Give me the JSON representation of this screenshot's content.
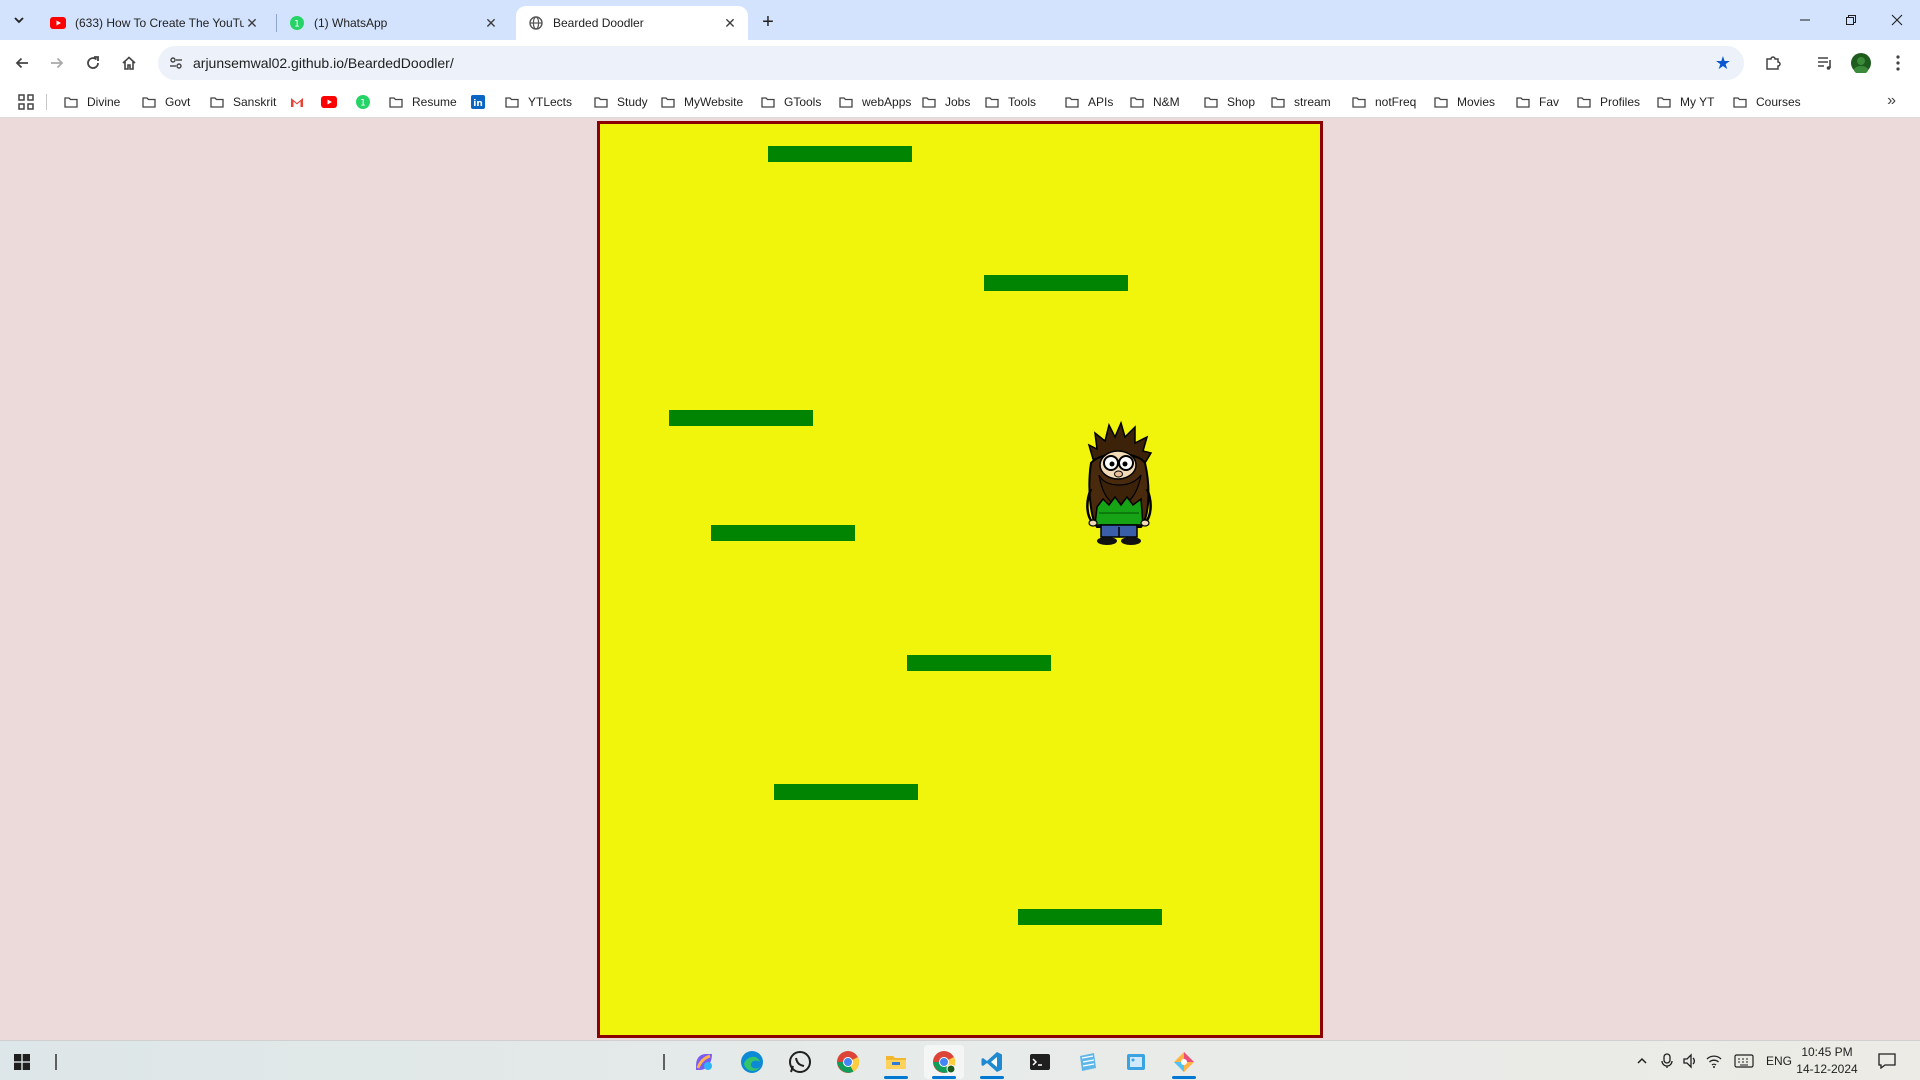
{
  "browser": {
    "tabs": [
      {
        "title": "(633) How To Create The YouTu",
        "favicon": "youtube-icon",
        "active": false
      },
      {
        "title": "(1) WhatsApp",
        "favicon": "whatsapp-icon",
        "active": false
      },
      {
        "title": "Bearded Doodler",
        "favicon": "globe-icon",
        "active": true
      }
    ],
    "url": "arjunsemwal02.github.io/BeardedDoodler/",
    "bookmarks": [
      {
        "label": "Divine",
        "icon": "folder-icon"
      },
      {
        "label": "Govt",
        "icon": "folder-icon"
      },
      {
        "label": "Sanskrit",
        "icon": "folder-icon"
      },
      {
        "label": "",
        "icon": "gmail-icon"
      },
      {
        "label": "",
        "icon": "youtube-icon"
      },
      {
        "label": "",
        "icon": "whatsapp-icon"
      },
      {
        "label": "Resume",
        "icon": "folder-icon"
      },
      {
        "label": "",
        "icon": "linkedin-icon"
      },
      {
        "label": "YTLects",
        "icon": "folder-icon"
      },
      {
        "label": "Study",
        "icon": "folder-icon"
      },
      {
        "label": "MyWebsite",
        "icon": "folder-icon"
      },
      {
        "label": "GTools",
        "icon": "folder-icon"
      },
      {
        "label": "webApps",
        "icon": "folder-icon"
      },
      {
        "label": "Jobs",
        "icon": "folder-icon"
      },
      {
        "label": "Tools",
        "icon": "folder-icon"
      },
      {
        "label": "APIs",
        "icon": "folder-icon"
      },
      {
        "label": "N&M",
        "icon": "folder-icon"
      },
      {
        "label": "Shop",
        "icon": "folder-icon"
      },
      {
        "label": "stream",
        "icon": "folder-icon"
      },
      {
        "label": "notFreq",
        "icon": "folder-icon"
      },
      {
        "label": "Movies",
        "icon": "folder-icon"
      },
      {
        "label": "Fav",
        "icon": "folder-icon"
      },
      {
        "label": "Profiles",
        "icon": "folder-icon"
      },
      {
        "label": "My YT",
        "icon": "folder-icon"
      },
      {
        "label": "Courses",
        "icon": "folder-icon"
      }
    ]
  },
  "game": {
    "platform_count": 7,
    "player": "bearded-doodler-character",
    "colors": {
      "background": "#f1f50b",
      "border": "#8b0000",
      "platform": "#018401",
      "page": "#ecdadb"
    }
  },
  "taskbar": {
    "apps": [
      "copilot-icon",
      "edge-icon",
      "whatsapp-icon",
      "chrome-icon",
      "file-explorer-icon",
      "chrome-profile-icon",
      "vscode-icon",
      "terminal-icon",
      "notepad-icon",
      "snipping-tool-icon",
      "paint-icon"
    ],
    "language": "ENG",
    "time": "10:45 PM",
    "date": "14-12-2024"
  }
}
